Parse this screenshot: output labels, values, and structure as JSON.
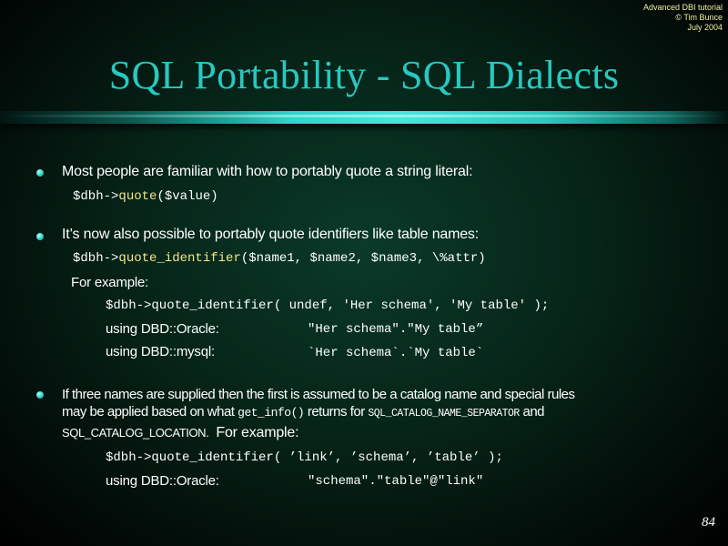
{
  "copyright": {
    "line1": "Advanced DBI tutorial",
    "line2": "© Tim Bunce",
    "line3": "July 2004"
  },
  "title": "SQL Portability - SQL Dialects",
  "bullet1": {
    "text": "Most people are familiar with how to portably quote a string literal:",
    "code_pre": "$dbh->",
    "code_kw": "quote",
    "code_post": "($value)"
  },
  "bullet2": {
    "text": "It’s now also possible to portably quote identifiers like table names:",
    "code_pre": "$dbh->",
    "code_kw": "quote_identifier",
    "code_post": "($name1, $name2, $name3, \\%attr)",
    "example_label": "For example:",
    "example_code": "$dbh->quote_identifier( undef, 'Her schema', 'My table' );",
    "oracle_label": "using DBD::Oracle:",
    "oracle_value": "\"Her schema\".\"My table”",
    "mysql_label": "using DBD::mysql:",
    "mysql_value": "`Her schema`.`My table`"
  },
  "bullet3": {
    "line1": "If three names are supplied then the first is assumed to be a catalog name and special rules",
    "line2_pre": "may be applied based on what ",
    "line2_code1": "get_info()",
    "line2_mid": " returns for ",
    "line2_code2": "SQL_CATALOG_NAME_SEPARATOR",
    "line2_post": " and",
    "line3_a": "SQL_CATALOG_LOCATION.",
    "line3_b": "For example:",
    "example_code": "$dbh->quote_identifier( ’link’, ’schema’, ’table’ );",
    "oracle_label": "using DBD::Oracle:",
    "oracle_value": "\"schema\".\"table\"@\"link\""
  },
  "page_number": "84",
  "colors": {
    "title": "#28c8c0",
    "method_highlight": "#f5e680",
    "copyright": "#f5f0a0"
  }
}
